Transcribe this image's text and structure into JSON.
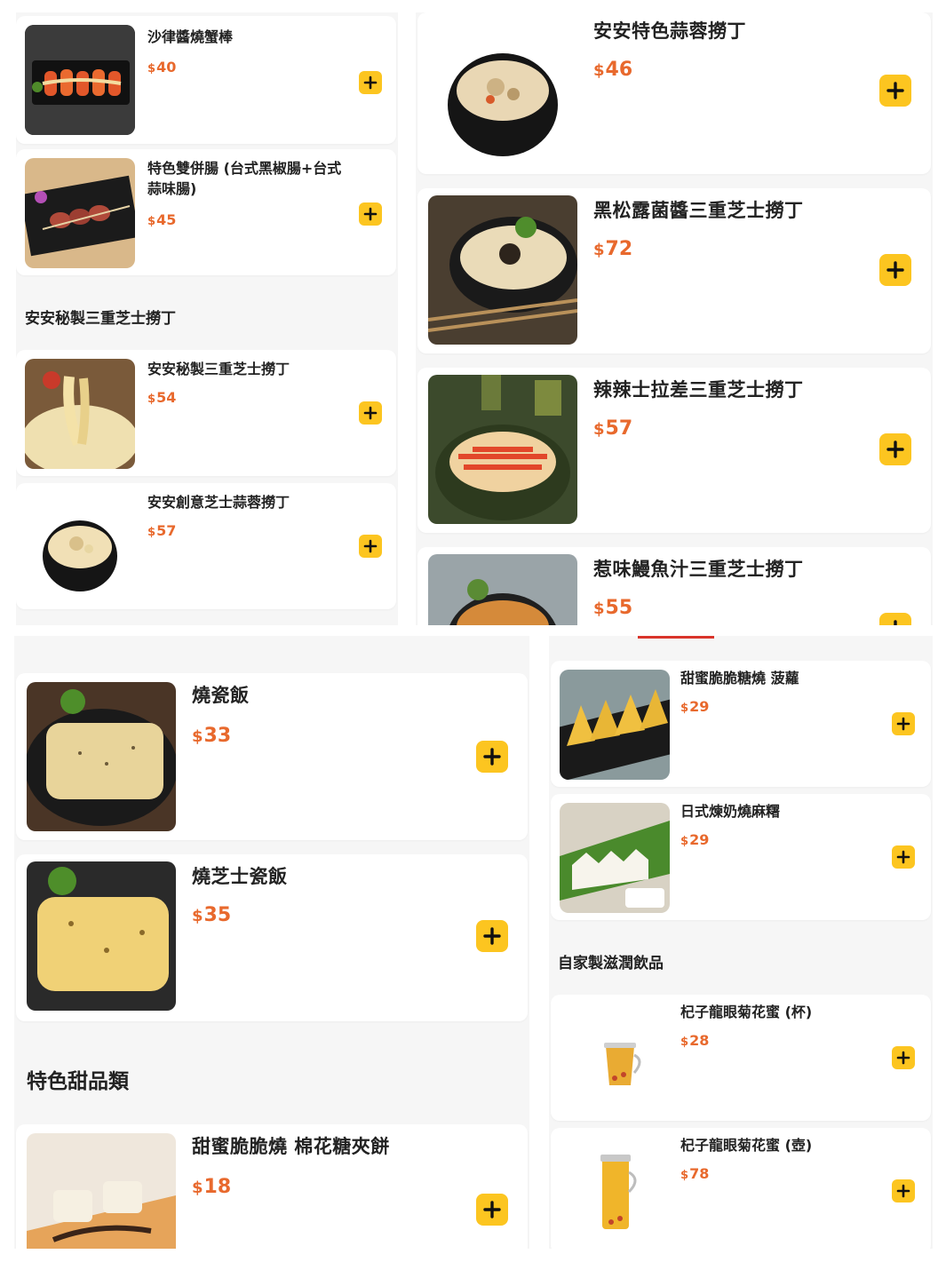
{
  "colors": {
    "accent_yellow": "#fcc520",
    "price_orange": "#e8692d",
    "panel_bg": "#f6f6f6",
    "card_bg": "#ffffff"
  },
  "icons": {
    "add": "plus-icon"
  },
  "panels": {
    "top_left": {
      "items": [
        {
          "name": "沙律醬燒蟹棒",
          "currency": "$",
          "price": "40"
        },
        {
          "name": "特色雙併腸 (台式黑椒腸+台式蒜味腸)",
          "currency": "$",
          "price": "45"
        }
      ],
      "section": "安安秘製三重芝士撈丁",
      "items2": [
        {
          "name": "安安秘製三重芝士撈丁",
          "currency": "$",
          "price": "54"
        },
        {
          "name": "安安創意芝士蒜蓉撈丁",
          "currency": "$",
          "price": "57"
        }
      ]
    },
    "top_right": {
      "items": [
        {
          "name": "安安特色蒜蓉撈丁",
          "currency": "$",
          "price": "46"
        },
        {
          "name": "黑松露菌醬三重芝士撈丁",
          "currency": "$",
          "price": "72"
        },
        {
          "name": "辣辣士拉差三重芝士撈丁",
          "currency": "$",
          "price": "57"
        },
        {
          "name": "惹味鰻魚汁三重芝士撈丁",
          "currency": "$",
          "price": "55"
        }
      ]
    },
    "bottom_left": {
      "items": [
        {
          "name": "燒瓷飯",
          "currency": "$",
          "price": "33"
        },
        {
          "name": "燒芝士瓷飯",
          "currency": "$",
          "price": "35"
        }
      ],
      "section": "特色甜品類",
      "items2": [
        {
          "name": "甜蜜脆脆燒 棉花糖夾餅",
          "currency": "$",
          "price": "18"
        }
      ]
    },
    "bottom_right": {
      "items": [
        {
          "name": "甜蜜脆脆糖燒 菠蘿",
          "currency": "$",
          "price": "29"
        },
        {
          "name": "日式煉奶燒麻糬",
          "currency": "$",
          "price": "29"
        }
      ],
      "section": "自家製滋潤飲品",
      "items2": [
        {
          "name": "杞子龍眼菊花蜜 (杯)",
          "currency": "$",
          "price": "28"
        },
        {
          "name": "杞子龍眼菊花蜜 (壺)",
          "currency": "$",
          "price": "78"
        }
      ]
    }
  }
}
